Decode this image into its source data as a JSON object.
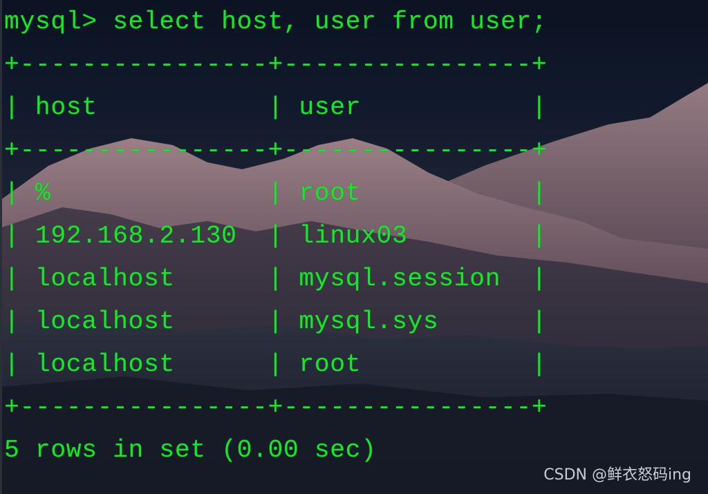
{
  "terminal": {
    "command_line": "mysql> select host, user from user;",
    "border_line": "+----------------+----------------+",
    "columns": [
      "host",
      "user"
    ],
    "rows": [
      [
        "%",
        "root"
      ],
      [
        "192.168.2.130",
        "linux03"
      ],
      [
        "localhost",
        "mysql.session"
      ],
      [
        "localhost",
        "mysql.sys"
      ],
      [
        "localhost",
        "root"
      ]
    ],
    "header_line": "| host           | user           |",
    "row_lines": [
      "| %              | root           |",
      "| 192.168.2.130  | linux03        |",
      "| localhost      | mysql.session  |",
      "| localhost      | mysql.sys      |",
      "| localhost      | root           |"
    ],
    "result_summary": "5 rows in set (0.00 sec)",
    "text_color": "#17e62a"
  },
  "watermark": "CSDN @鲜衣怒码ing"
}
